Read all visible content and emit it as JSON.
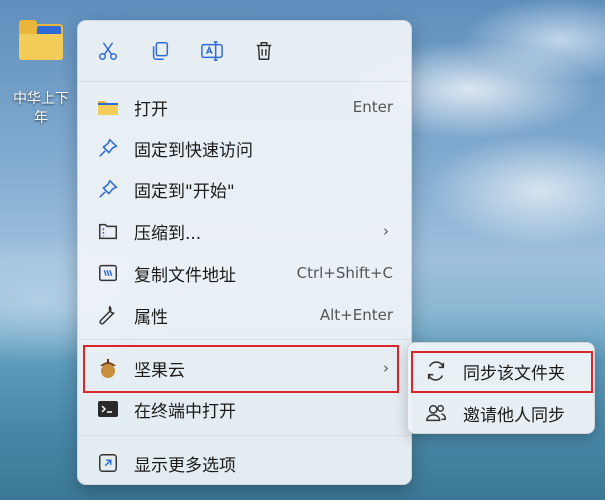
{
  "desktop": {
    "folder_label": "中华上下五千年",
    "label_line1": "中华上下",
    "label_line2": "年"
  },
  "toolbar": {
    "cut_icon": "scissors-icon",
    "copy_icon": "copy-icon",
    "rename_icon": "rename-icon",
    "delete_icon": "trash-icon"
  },
  "menu": {
    "items": [
      {
        "label": "打开",
        "shortcut": "Enter",
        "icon": "folder-icon"
      },
      {
        "label": "固定到快速访问",
        "icon": "pin-icon"
      },
      {
        "label": "固定到\"开始\"",
        "icon": "pin-icon"
      },
      {
        "label": "压缩到...",
        "icon": "zip-icon",
        "chevron": "›"
      },
      {
        "label": "复制文件地址",
        "shortcut": "Ctrl+Shift+C",
        "icon": "path-icon"
      },
      {
        "label": "属性",
        "shortcut": "Alt+Enter",
        "icon": "wrench-icon"
      },
      {
        "label": "坚果云",
        "icon": "nut-icon",
        "chevron": "›"
      },
      {
        "label": "在终端中打开",
        "icon": "terminal-icon"
      },
      {
        "label": "显示更多选项",
        "icon": "more-options-icon"
      }
    ]
  },
  "submenu": {
    "items": [
      {
        "label": "同步该文件夹",
        "icon": "sync-icon"
      },
      {
        "label": "邀请他人同步",
        "icon": "people-icon"
      }
    ]
  },
  "colors": {
    "highlight": "#d9262c",
    "accent": "#2f6bd8"
  }
}
